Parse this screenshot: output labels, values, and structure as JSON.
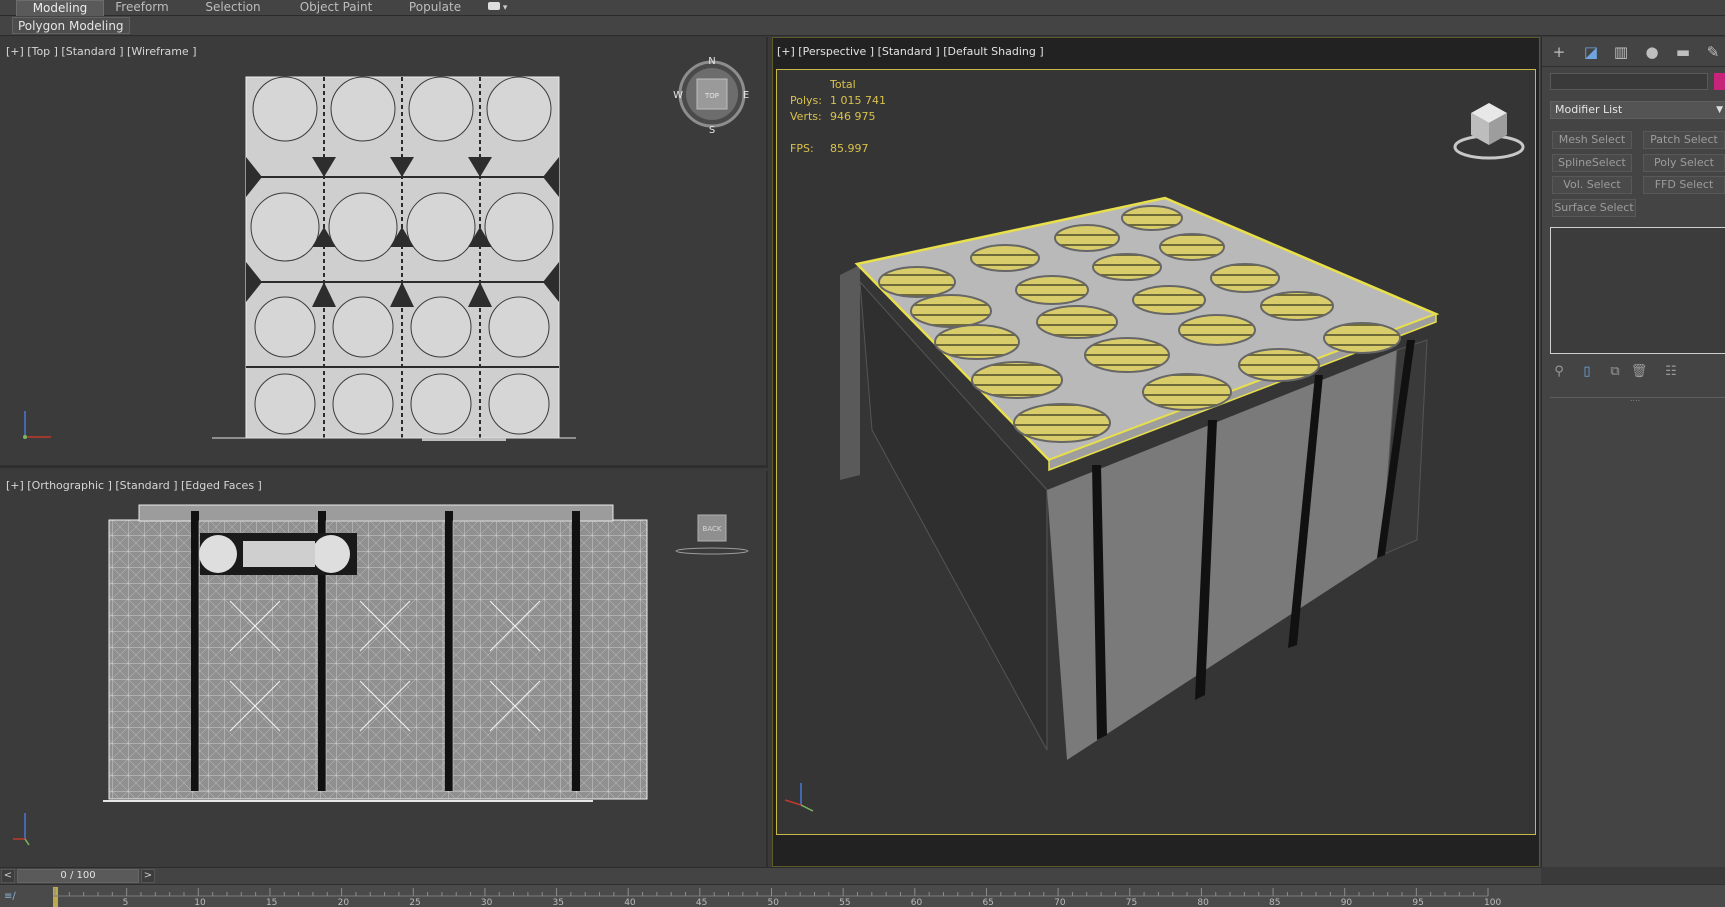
{
  "ribbon": {
    "tabs": [
      "Modeling",
      "Freeform",
      "Selection",
      "Object Paint",
      "Populate"
    ],
    "active_tab": "Modeling",
    "sub_label": "Polygon Modeling"
  },
  "viewports": {
    "top": {
      "label": "[+] [Top ] [Standard ] [Wireframe ]",
      "compass": {
        "n": "N",
        "s": "S",
        "e": "E",
        "w": "W",
        "cube": "TOP"
      }
    },
    "ortho": {
      "label": "[+] [Orthographic ] [Standard ] [Edged Faces ]",
      "cube": "BACK"
    },
    "persp": {
      "label": "[+] [Perspective ] [Standard ] [Default Shading ]",
      "stats": {
        "header": "Total",
        "polys_label": "Polys:",
        "polys": "1 015 741",
        "verts_label": "Verts:",
        "verts": "946 975",
        "fps_label": "FPS:",
        "fps": "85.997"
      }
    }
  },
  "command_panel": {
    "modifier_list": "Modifier List",
    "buttons": [
      "Mesh Select",
      "Patch Select",
      "SplineSelect",
      "Poly Select",
      "Vol. Select",
      "FFD Select",
      "Surface Select"
    ],
    "colors": {
      "object_swatch": "#c8237a",
      "selection": "#d9c24d"
    }
  },
  "timeline": {
    "frame": "0 / 100",
    "prev": "<",
    "next": ">",
    "ticks": [
      "5",
      "10",
      "15",
      "20",
      "25",
      "30",
      "35",
      "40",
      "45",
      "50",
      "55",
      "60",
      "65",
      "70",
      "75",
      "80",
      "85",
      "90",
      "95",
      "100"
    ]
  }
}
